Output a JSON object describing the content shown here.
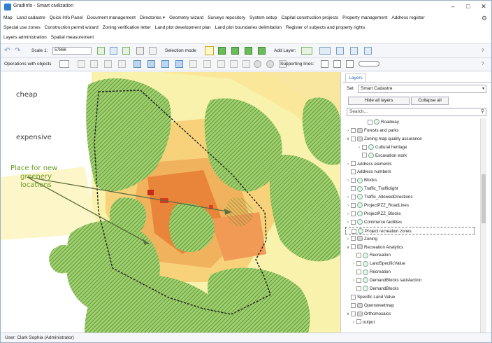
{
  "window": {
    "title": "GradInfo - Smart civilization"
  },
  "menu": {
    "row1": [
      "Map",
      "Land cadastre",
      "Quick Info Panel",
      "Document management",
      "Directories ▾",
      "Geometry wizard",
      "Surveys repository",
      "System setup",
      "Capital construction projects",
      "Property management",
      "Address register"
    ],
    "row2": [
      "Special use zones",
      "Construction permit wizard",
      "Zoning verification letter",
      "Land plot development plan",
      "Land plot boundaries delimitation",
      "Register of subjects and property rights"
    ],
    "row3": [
      "Layers administration",
      "Spatial measurement"
    ]
  },
  "toolbar": {
    "scale_label": "Scale 1:",
    "scale_value": "57866",
    "selection_mode": "Selection mode",
    "add_layer": "Add Layer:",
    "operations": "Operations with objects",
    "supporting_lines": "Supporting lines:",
    "help": "?"
  },
  "map": {
    "label_cheap": "cheap",
    "label_expensive": "expensive",
    "label_greenery": [
      "Place for new",
      "greenery",
      "locations"
    ]
  },
  "panel": {
    "tab": "Layers",
    "set_label": "Set",
    "set_value": "Smart Cadastre",
    "hide_all": "Hide all layers",
    "collapse_all": "Collapse all",
    "search_placeholder": "Search...",
    "tree": [
      {
        "label": "Roadway",
        "indent": 3,
        "exp": "",
        "cb": true,
        "icon": "layer"
      },
      {
        "label": "Forests and parks",
        "indent": 0,
        "exp": ">",
        "cb": true,
        "icon": "folder"
      },
      {
        "label": "Zoning map quality assurance",
        "indent": 0,
        "exp": "v",
        "cb": true,
        "icon": "folder"
      },
      {
        "label": "Cultural heritage",
        "indent": 2,
        "exp": ">",
        "cb": true,
        "icon": "layer"
      },
      {
        "label": "Excavation work",
        "indent": 2,
        "exp": "",
        "cb": true,
        "icon": "layer"
      },
      {
        "label": "Address elements",
        "indent": 0,
        "exp": ">",
        "cb": true,
        "icon": "none"
      },
      {
        "label": "Address numbers",
        "indent": 0,
        "exp": "",
        "cb": true,
        "icon": "none"
      },
      {
        "label": "Blocks",
        "indent": 0,
        "exp": ">",
        "cb": true,
        "icon": "layer"
      },
      {
        "label": "Traffic_Trafficlight",
        "indent": 0,
        "exp": "",
        "cb": true,
        "icon": "layer"
      },
      {
        "label": "Traffic_AllowedDirections",
        "indent": 0,
        "exp": ">",
        "cb": true,
        "icon": "layer"
      },
      {
        "label": "ProjectPZZ_RoadLines",
        "indent": 0,
        "exp": ">",
        "cb": true,
        "icon": "layer"
      },
      {
        "label": "ProjectPZZ_Blocks",
        "indent": 0,
        "exp": ">",
        "cb": true,
        "icon": "layer"
      },
      {
        "label": "Commerce facilities",
        "indent": 0,
        "exp": ">",
        "cb": true,
        "icon": "layer"
      },
      {
        "label": "Project recreation zones",
        "indent": 0,
        "exp": "",
        "cb": true,
        "icon": "layer"
      },
      {
        "label": "Zoning",
        "indent": 0,
        "exp": ">",
        "cb": false,
        "icon": "folder"
      },
      {
        "label": "Recreation Analytics",
        "indent": 0,
        "exp": "v",
        "cb": true,
        "icon": "folder"
      },
      {
        "label": "Recreation",
        "indent": 1,
        "exp": "",
        "cb": true,
        "icon": "layer"
      },
      {
        "label": "LandSpecificValue",
        "indent": 1,
        "exp": ">",
        "cb": true,
        "icon": "layer"
      },
      {
        "label": "Recreation",
        "indent": 1,
        "exp": "",
        "cb": false,
        "icon": "layer"
      },
      {
        "label": "DemandBlocks satisfaction",
        "indent": 1,
        "exp": ">",
        "cb": false,
        "icon": "layer"
      },
      {
        "label": "DemandBlocks",
        "indent": 1,
        "exp": "",
        "cb": false,
        "icon": "layer"
      },
      {
        "label": "Specific Land Value",
        "indent": 0,
        "exp": "",
        "cb": false,
        "icon": "none"
      },
      {
        "label": "Openstreetmap",
        "indent": 0,
        "exp": "",
        "cb": false,
        "icon": "folder"
      },
      {
        "label": "Orthomosaics",
        "indent": 0,
        "exp": "v",
        "cb": false,
        "icon": "folder"
      },
      {
        "label": "output",
        "indent": 1,
        "exp": ">",
        "cb": false,
        "icon": "none"
      }
    ]
  },
  "status": {
    "user": "User: Clark Sophia   (Administrator)"
  },
  "colors": {
    "accent": "#2f7fd1",
    "green": "#4a9a3a",
    "yellow": "#f7f0a6",
    "orange": "#e8742a"
  }
}
